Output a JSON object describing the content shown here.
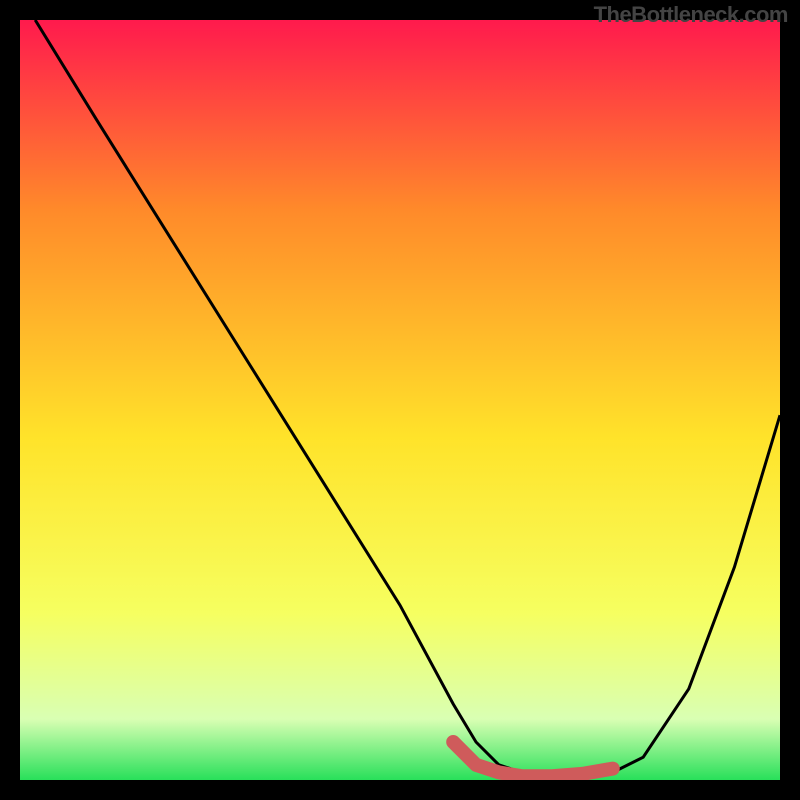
{
  "watermark": "TheBottleneck.com",
  "chart_data": {
    "type": "line",
    "title": "",
    "xlabel": "",
    "ylabel": "",
    "xlim": [
      0,
      100
    ],
    "ylim": [
      0,
      100
    ],
    "grid": false,
    "series": [
      {
        "name": "curve",
        "color": "#000000",
        "x": [
          2,
          10,
          20,
          30,
          40,
          50,
          57,
          60,
          63,
          66,
          70,
          74,
          78,
          82,
          88,
          94,
          100
        ],
        "y": [
          100,
          87,
          71,
          55,
          39,
          23,
          10,
          5,
          2,
          1,
          0.5,
          0.5,
          1,
          3,
          12,
          28,
          48
        ]
      },
      {
        "name": "bottom-segment",
        "color": "#cf5b5b",
        "thick": true,
        "x": [
          57,
          60,
          63,
          66,
          70,
          74,
          78
        ],
        "y": [
          5,
          2,
          1,
          0.5,
          0.5,
          0.8,
          1.5
        ]
      }
    ],
    "background_gradient": {
      "top": "#ff1a4d",
      "upper_mid": "#ff8a2a",
      "mid": "#ffe32a",
      "lower_mid": "#f6ff60",
      "near_bottom": "#d9ffb3",
      "bottom": "#28e05a"
    }
  }
}
